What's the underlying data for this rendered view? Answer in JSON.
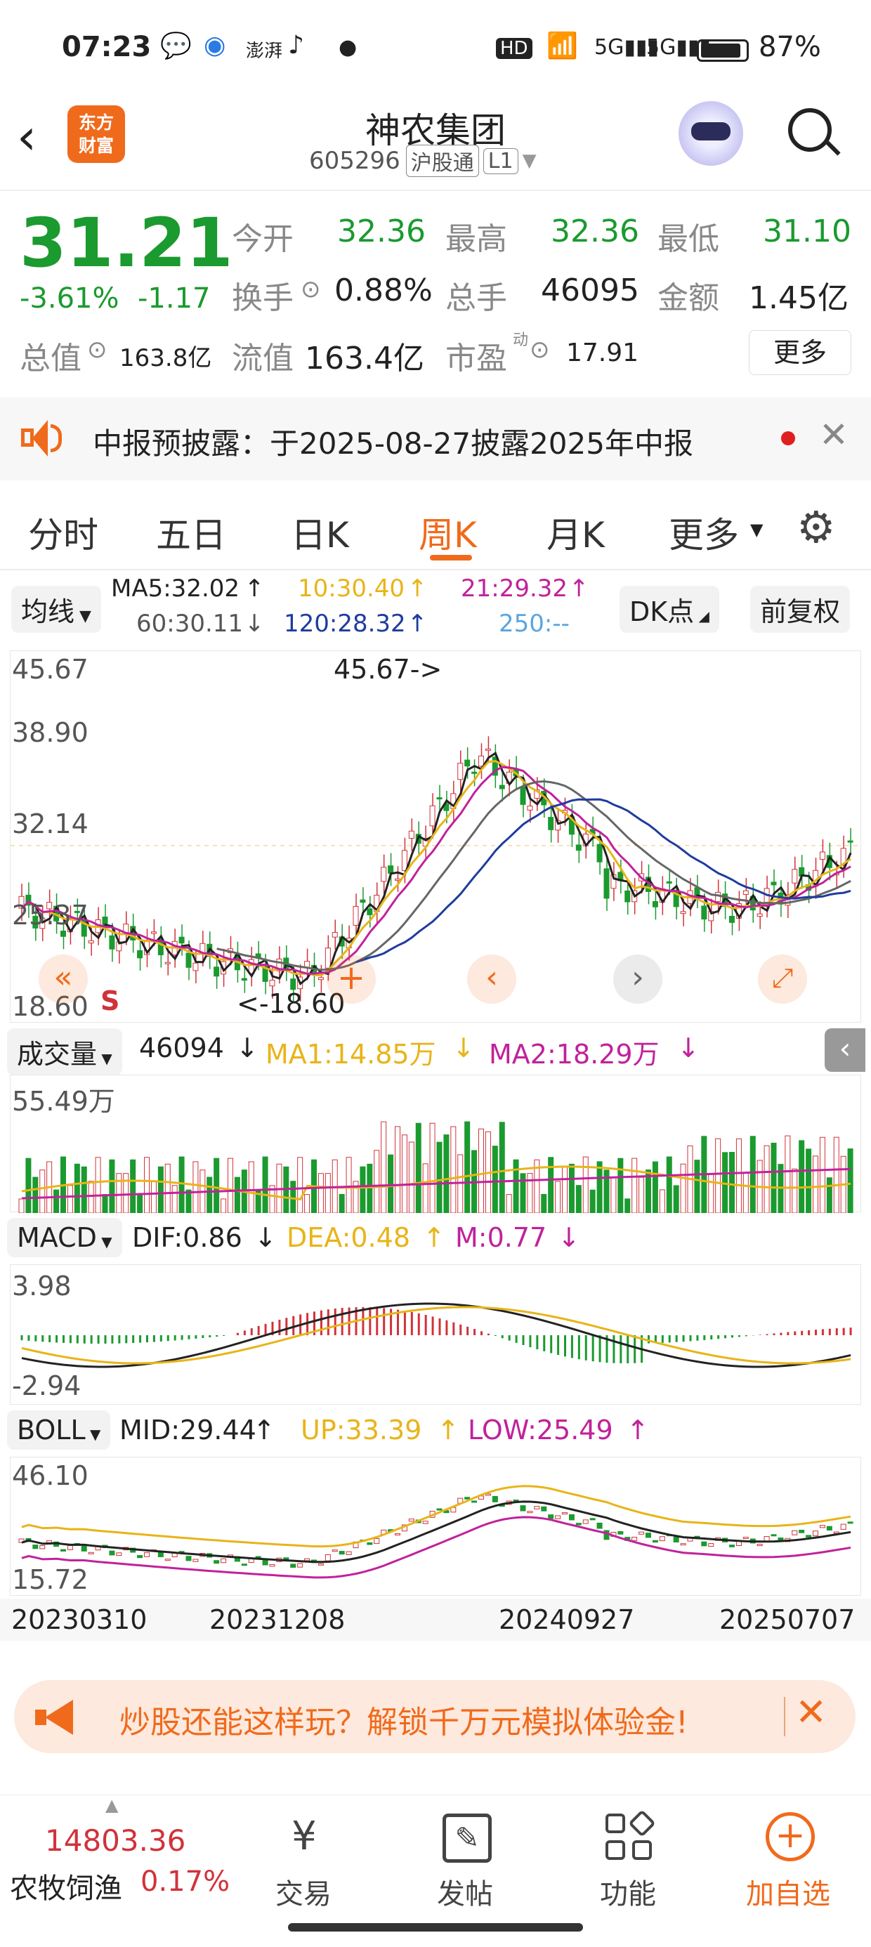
{
  "status": {
    "time": "07:23",
    "battery": "87%",
    "icons": [
      "wechat-icon",
      "app-icon",
      "news-icon",
      "tiktok-icon",
      "dot-icon",
      "hd-icon",
      "wifi-icon",
      "signal-5g-icon",
      "signal-5g-icon",
      "battery-icon"
    ]
  },
  "header": {
    "logo_text": "东方\n财富",
    "title": "神农集团",
    "code": "605296",
    "tag1": "沪股通",
    "tag2": "L1"
  },
  "quote": {
    "price": "31.21",
    "change_pct": "-3.61%",
    "change": "-1.17",
    "open_label": "今开",
    "open": "32.36",
    "high_label": "最高",
    "high": "32.36",
    "low_label": "最低",
    "low": "31.10",
    "turnover_label": "换手",
    "turnover": "0.88%",
    "volume_label": "总手",
    "volume": "46095",
    "amount_label": "金额",
    "amount": "1.45亿",
    "mktcap_label": "总值",
    "mktcap": "163.8亿",
    "float_label": "流值",
    "float": "163.4亿",
    "pe_label": "市盈",
    "pe_sup": "动",
    "pe": "17.91",
    "more": "更多"
  },
  "notice": {
    "text": "中报预披露：于2025-08-27披露2025年中报"
  },
  "tabs": {
    "items": [
      "分时",
      "五日",
      "日K",
      "周K",
      "月K",
      "更多"
    ],
    "active": 3
  },
  "ma": {
    "selector": "均线",
    "ma5": "MA5:32.02",
    "ma10": "10:30.40",
    "ma21": "21:29.32",
    "ma60": "60:30.11",
    "ma120": "120:28.32",
    "ma250": "250:--",
    "dk": "DK点",
    "fq": "前复权"
  },
  "kline": {
    "top_label": "45.67",
    "l2": "38.90",
    "l3": "32.14",
    "l4": "25.37",
    "bottom_label": "18.60",
    "max_note": "45.67->",
    "min_note": "<-18.60",
    "s_mark": "S"
  },
  "volume": {
    "selector": "成交量",
    "value": "46094",
    "ma1": "MA1:14.85万",
    "ma2": "MA2:18.29万",
    "top_label": "55.49万"
  },
  "macd": {
    "selector": "MACD",
    "dif": "DIF:0.86",
    "dea": "DEA:0.48",
    "m": "M:0.77",
    "top_label": "3.98",
    "bottom_label": "-2.94"
  },
  "boll": {
    "selector": "BOLL",
    "mid": "MID:29.44",
    "up": "UP:33.39",
    "low": "LOW:25.49",
    "top_label": "46.10",
    "bottom_label": "15.72"
  },
  "dates": [
    "20230310",
    "20231208",
    "20240927",
    "20250707"
  ],
  "ad": {
    "text": "炒股还能这样玩？解锁千万元模拟体验金!"
  },
  "bottom": {
    "index_value": "14803.36",
    "index_name": "农牧饲渔",
    "index_pct": "0.17%",
    "trade": "交易",
    "post": "发帖",
    "func": "功能",
    "add": "加自选"
  },
  "colors": {
    "up": "#d1323a",
    "down": "#1a9a2f",
    "accent": "#f06a1c",
    "ma10": "#e8b418",
    "ma21": "#c0229b",
    "ma120": "#1f3c9e",
    "ma250": "#5aa5e0"
  }
}
